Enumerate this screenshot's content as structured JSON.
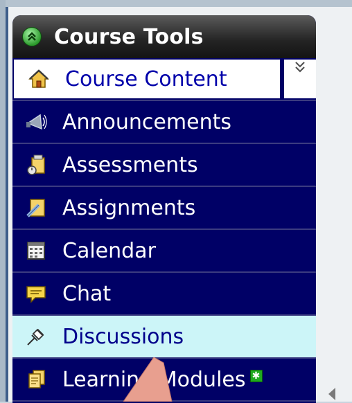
{
  "menu": {
    "title": "Course Tools",
    "items": [
      {
        "label": "Course Content",
        "icon": "home-icon"
      },
      {
        "label": "Announcements",
        "icon": "megaphone-icon"
      },
      {
        "label": "Assessments",
        "icon": "assessment-icon"
      },
      {
        "label": "Assignments",
        "icon": "assignment-icon"
      },
      {
        "label": "Calendar",
        "icon": "calendar-icon"
      },
      {
        "label": "Chat",
        "icon": "chat-bubble-icon"
      },
      {
        "label": "Discussions",
        "icon": "pushpin-icon"
      },
      {
        "label": "Learning Modules",
        "icon": "module-icon"
      }
    ],
    "selected_item": "Discussions",
    "new_badge": "✱"
  },
  "colors": {
    "panel_bg": "#000066",
    "selected_bg": "#ccf5f8",
    "header_bg": "#232323",
    "arrow": "#e89f8f"
  }
}
